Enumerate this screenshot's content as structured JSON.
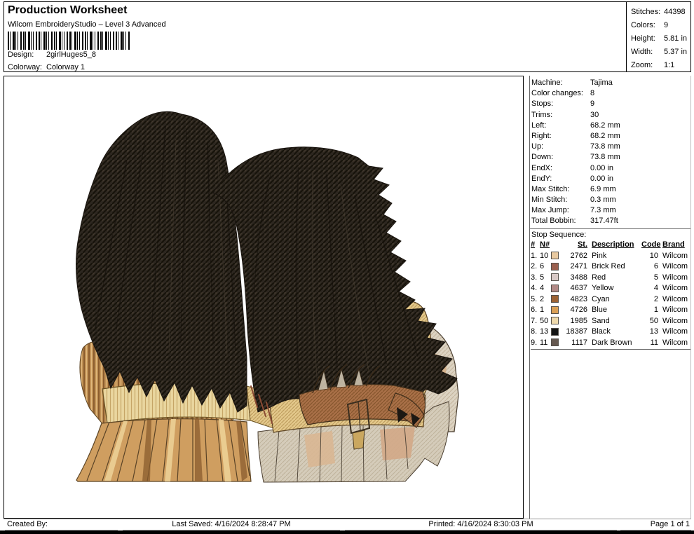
{
  "header": {
    "title": "Production Worksheet",
    "subtitle": "Wilcom EmbroideryStudio – Level 3 Advanced",
    "design_label": "Design:",
    "design_value": "2girlHuges5_8",
    "colorway_label": "Colorway:",
    "colorway_value": "Colorway 1",
    "stats": [
      {
        "label": "Stitches:",
        "value": "44398"
      },
      {
        "label": "Colors:",
        "value": "9"
      },
      {
        "label": "Height:",
        "value": "5.81 in"
      },
      {
        "label": "Width:",
        "value": "5.37 in"
      },
      {
        "label": "Zoom:",
        "value": "1:1"
      }
    ]
  },
  "machine_info": [
    {
      "label": "Machine:",
      "value": "Tajima"
    },
    {
      "label": "Color changes:",
      "value": "8"
    },
    {
      "label": "Stops:",
      "value": "9"
    },
    {
      "label": "Trims:",
      "value": "30"
    },
    {
      "label": "Left:",
      "value": "68.2 mm"
    },
    {
      "label": "Right:",
      "value": "68.2 mm"
    },
    {
      "label": "Up:",
      "value": "73.8 mm"
    },
    {
      "label": "Down:",
      "value": "73.8 mm"
    },
    {
      "label": "EndX:",
      "value": "0.00 in"
    },
    {
      "label": "EndY:",
      "value": "0.00 in"
    },
    {
      "label": "Max Stitch:",
      "value": "6.9 mm"
    },
    {
      "label": "Min Stitch:",
      "value": "0.3 mm"
    },
    {
      "label": "Max Jump:",
      "value": "7.3 mm"
    },
    {
      "label": "Total Bobbin:",
      "value": "317.47ft"
    }
  ],
  "stop_sequence": {
    "title": "Stop Sequence:",
    "columns": {
      "num": "#",
      "n": "N#",
      "st": "St.",
      "description": "Description",
      "code": "Code",
      "brand": "Brand"
    },
    "rows": [
      {
        "num": "1.",
        "n": "10",
        "swatch": "#e8c9a0",
        "st": "2762",
        "description": "Pink",
        "code": "10",
        "brand": "Wilcom"
      },
      {
        "num": "2.",
        "n": "6",
        "swatch": "#9a5f4e",
        "st": "2471",
        "description": "Brick Red",
        "code": "6",
        "brand": "Wilcom"
      },
      {
        "num": "3.",
        "n": "5",
        "swatch": "#d8c9c6",
        "st": "3488",
        "description": "Red",
        "code": "5",
        "brand": "Wilcom"
      },
      {
        "num": "4.",
        "n": "4",
        "swatch": "#b28a86",
        "st": "4637",
        "description": "Yellow",
        "code": "4",
        "brand": "Wilcom"
      },
      {
        "num": "5.",
        "n": "2",
        "swatch": "#9c6233",
        "st": "4823",
        "description": "Cyan",
        "code": "2",
        "brand": "Wilcom"
      },
      {
        "num": "6.",
        "n": "1",
        "swatch": "#d99f55",
        "st": "4726",
        "description": "Blue",
        "code": "1",
        "brand": "Wilcom"
      },
      {
        "num": "7.",
        "n": "50",
        "swatch": "#eed9ab",
        "st": "1985",
        "description": "Sand",
        "code": "50",
        "brand": "Wilcom"
      },
      {
        "num": "8.",
        "n": "13",
        "swatch": "#141414",
        "st": "18387",
        "description": "Black",
        "code": "13",
        "brand": "Wilcom"
      },
      {
        "num": "9.",
        "n": "11",
        "swatch": "#655850",
        "st": "1117",
        "description": "Dark Brown",
        "code": "11",
        "brand": "Wilcom"
      }
    ]
  },
  "design_preview": {
    "description": "Embroidery stitch-out preview: two girls with long dark hair embracing, one in a tan belted dress, one in a sand top with gold belt"
  },
  "footer": {
    "created_by": "Created By:",
    "last_saved": "Last Saved: 4/16/2024 8:28:47 PM",
    "printed": "Printed: 4/16/2024 8:30:03 PM",
    "page": "Page 1 of 1"
  }
}
